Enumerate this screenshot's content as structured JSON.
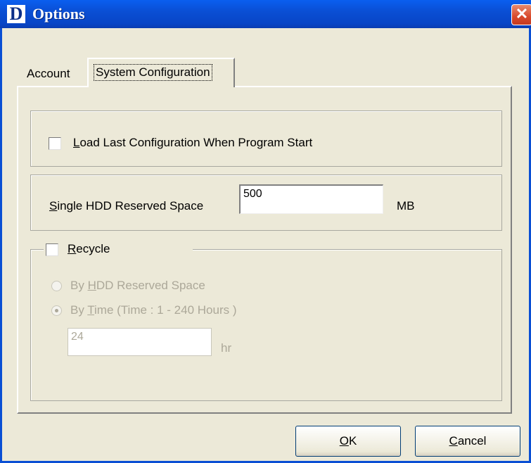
{
  "window": {
    "title": "Options",
    "app_icon_letter": "D",
    "close_glyph": "✕"
  },
  "tabs": [
    {
      "label": "Account",
      "selected": false
    },
    {
      "label": "System Configuration",
      "selected": true
    }
  ],
  "load_last": {
    "checked": false,
    "label_mnemonic": "L",
    "label_rest": "oad Last Configuration When Program Start"
  },
  "reserved_space": {
    "label_mnemonic": "S",
    "label_rest": "ingle HDD Reserved Space",
    "value": "500",
    "unit": "MB"
  },
  "recycle": {
    "checked": false,
    "label_mnemonic": "R",
    "label_rest": "ecycle",
    "options": [
      {
        "prefix": "By ",
        "mnemonic": "H",
        "rest": "DD Reserved Space",
        "selected": false,
        "enabled": false
      },
      {
        "prefix": "By ",
        "mnemonic": "T",
        "rest": "ime (Time : 1 - 240 Hours )",
        "selected": true,
        "enabled": false
      }
    ],
    "hours_value": "24",
    "hours_unit": "hr"
  },
  "buttons": {
    "ok_mnemonic": "O",
    "ok_rest": "K",
    "cancel_mnemonic": "C",
    "cancel_rest": "ancel"
  },
  "colors": {
    "titlebar": "#0a4fd4",
    "dialog_bg": "#ece9d8",
    "disabled_text": "#aca899",
    "close_button": "#d9492b"
  }
}
